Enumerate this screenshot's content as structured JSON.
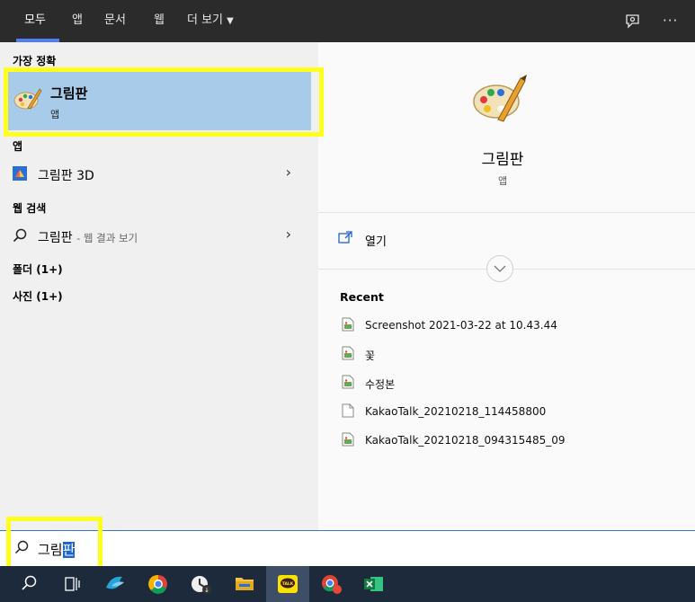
{
  "tabs": [
    "모두",
    "앱",
    "문서",
    "웹",
    "더 보기"
  ],
  "sections": {
    "best_match": "가장 정확",
    "apps": "앱",
    "web_search": "웹 검색",
    "folders": "폴더 (1+)",
    "photos": "사진 (1+)"
  },
  "best_match": {
    "title": "그림판",
    "subtitle": "앱"
  },
  "apps": [
    {
      "label": "그림판 3D"
    }
  ],
  "web": {
    "query": "그림판",
    "suffix": "- 웹 결과 보기"
  },
  "detail": {
    "name": "그림판",
    "type": "앱",
    "open_label": "열기",
    "recent_title": "Recent",
    "recent": [
      {
        "name": "Screenshot 2021-03-22 at 10.43.44",
        "icon": "image-file-icon"
      },
      {
        "name": "꽃",
        "icon": "image-file-icon"
      },
      {
        "name": "수정본",
        "icon": "image-file-icon"
      },
      {
        "name": "KakaoTalk_20210218_114458800",
        "icon": "blank-file-icon"
      },
      {
        "name": "KakaoTalk_20210218_094315485_09",
        "icon": "image-file-icon"
      }
    ]
  },
  "search": {
    "typed": "그림",
    "selected": "판"
  },
  "taskbar": [
    "search-icon",
    "task-view-icon",
    "bird-app-icon",
    "chrome-icon",
    "clock-app-icon",
    "file-explorer-icon",
    "kakaotalk-icon",
    "chrome-profile-icon",
    "excel-icon"
  ],
  "colors": {
    "accent": "#1e63d6",
    "selection": "#a9cbea",
    "highlight": "#ffff1c"
  }
}
